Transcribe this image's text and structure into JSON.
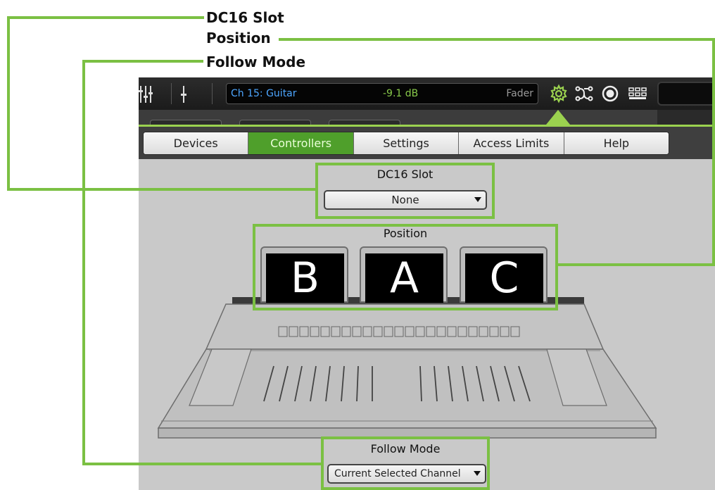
{
  "callouts": {
    "dc16_slot": "DC16 Slot",
    "position": "Position",
    "follow_mode": "Follow Mode"
  },
  "topbar": {
    "channel_name": "Ch 15: Guitar",
    "level": "-9.1 dB",
    "mode": "Fader",
    "icons": [
      "mixer-icon",
      "fader-icon",
      "gear-icon",
      "routing-icon",
      "record-icon",
      "grid-icon"
    ]
  },
  "tabs": [
    {
      "label": "Devices",
      "active": false
    },
    {
      "label": "Controllers",
      "active": true
    },
    {
      "label": "Settings",
      "active": false
    },
    {
      "label": "Access Limits",
      "active": false
    },
    {
      "label": "Help",
      "active": false
    }
  ],
  "dc16_slot": {
    "title": "DC16 Slot",
    "value": "None"
  },
  "position": {
    "title": "Position",
    "slots": [
      "B",
      "A",
      "C"
    ]
  },
  "follow_mode": {
    "title": "Follow Mode",
    "value": "Current Selected Channel"
  },
  "colors": {
    "accent_green": "#7bc043",
    "active_tab": "#4f9f2b",
    "channel_blue": "#4da6ff",
    "level_green": "#88c94a"
  }
}
